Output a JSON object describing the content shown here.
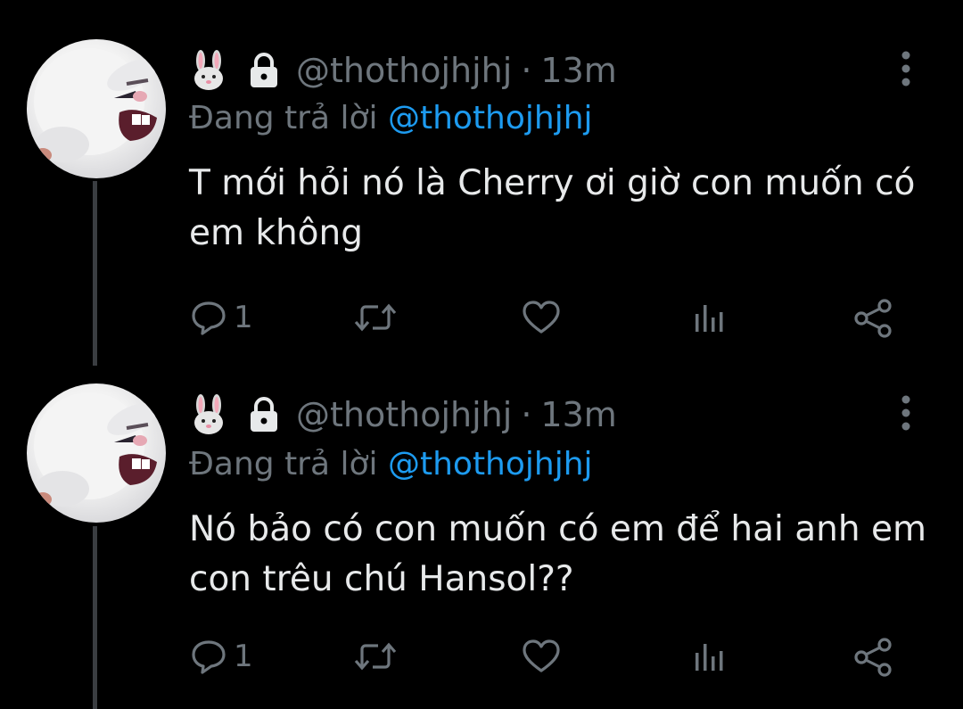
{
  "colors": {
    "background": "#000000",
    "text": "#e7e9ea",
    "secondary": "#6e767d",
    "link": "#1d9bf0"
  },
  "tweets": [
    {
      "emoji_icon": "rabbit-face-emoji",
      "lock_icon": "lock-icon",
      "handle": "@thothojhjhj",
      "separator": "·",
      "time": "13m",
      "replying_prefix": "Đang trả lời",
      "replying_handle": "@thothojhjhj",
      "text": "T mới hỏi nó là Cherry ơi giờ con muốn có em không",
      "reply_count": "1"
    },
    {
      "emoji_icon": "rabbit-face-emoji",
      "lock_icon": "lock-icon",
      "handle": "@thothojhjhj",
      "separator": "·",
      "time": "13m",
      "replying_prefix": "Đang trả lời",
      "replying_handle": "@thothojhjhj",
      "text": "Nó bảo có con muốn có em để hai anh em con trêu chú Hansol??",
      "reply_count": "1"
    }
  ]
}
